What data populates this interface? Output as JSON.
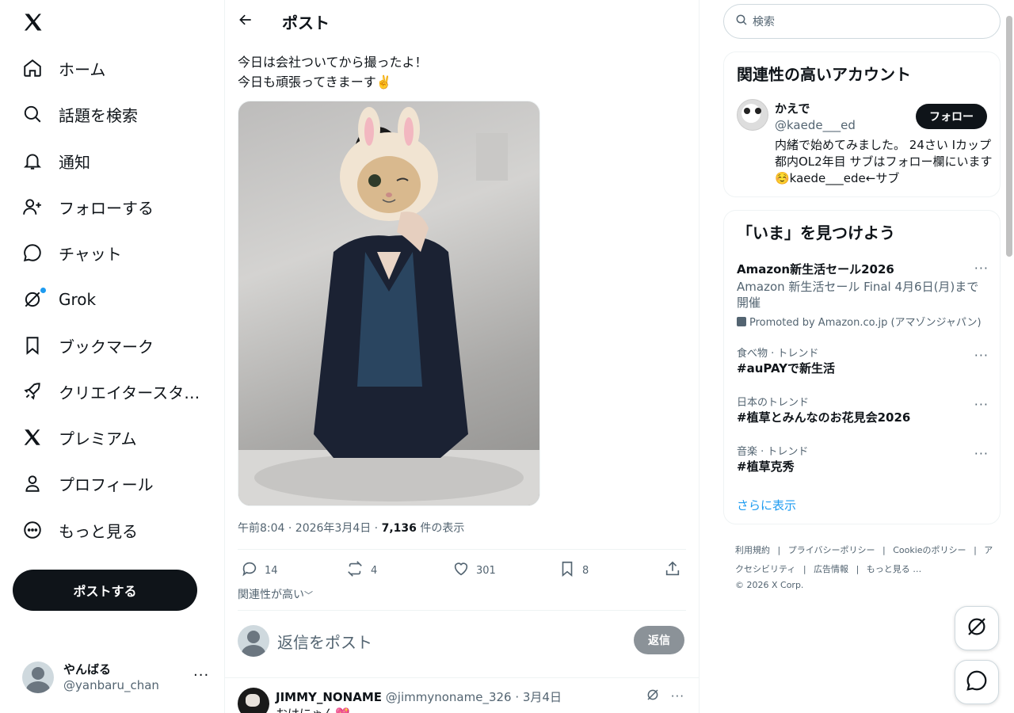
{
  "nav": {
    "items": [
      {
        "label": "ホーム",
        "icon": "home-icon"
      },
      {
        "label": "話題を検索",
        "icon": "search-icon"
      },
      {
        "label": "通知",
        "icon": "bell-icon"
      },
      {
        "label": "フォローする",
        "icon": "person-add-icon"
      },
      {
        "label": "チャット",
        "icon": "chat-icon"
      },
      {
        "label": "Grok",
        "icon": "grok-icon"
      },
      {
        "label": "ブックマーク",
        "icon": "bookmark-icon"
      },
      {
        "label": "クリエイタースタ…",
        "icon": "rocket-icon"
      },
      {
        "label": "プレミアム",
        "icon": "x-icon"
      },
      {
        "label": "プロフィール",
        "icon": "person-icon"
      },
      {
        "label": "もっと見る",
        "icon": "more-circle-icon"
      }
    ],
    "post_button": "ポストする",
    "account": {
      "name": "やんばる",
      "handle": "@yanbaru_chan",
      "more": "···"
    }
  },
  "header": {
    "title": "ポスト"
  },
  "post": {
    "line1": "今日は会社ついてから撮ったよ！",
    "line2": "今日も頑張ってきまーす✌️",
    "time": "午前8:04 · 2026年3月4日 · ",
    "views": "7,136",
    "views_suffix": " 件の表示",
    "replies": "14",
    "reposts": "4",
    "likes": "301",
    "bookmarks": "8",
    "sort_label": "関連性が高い"
  },
  "reply_box": {
    "placeholder": "返信をポスト",
    "button": "返信"
  },
  "reply": {
    "name": "JIMMY_NONAME",
    "meta": " @jimmynoname_326 · 3月4日",
    "text": "おはにゃん💖"
  },
  "search": {
    "placeholder": "検索"
  },
  "relevant": {
    "title": "関連性の高いアカウント",
    "name": "かえで",
    "handle": "@kaede___ed",
    "bio": "内緒で始めてみました。 24さい Iカップ 都内OL2年目 サブはフォロー欄にいます☺️kaede___ede←サブ",
    "follow": "フォロー"
  },
  "trends": {
    "title": "「いま」を見つけよう",
    "promo": {
      "title": "Amazon新生活セール2026",
      "desc": "Amazon 新生活セール Final 4月6日(月)まで開催",
      "by": "Promoted by Amazon.co.jp (アマゾンジャパン)"
    },
    "items": [
      {
        "meta": "食べ物 · トレンド",
        "title": "#auPAYで新生活"
      },
      {
        "meta": "日本のトレンド",
        "title": "#植草とみんなのお花見会2026"
      },
      {
        "meta": "音楽 · トレンド",
        "title": "#植草克秀"
      }
    ],
    "more_dots": "···",
    "show_more": "さらに表示"
  },
  "footer": {
    "links": [
      "利用規約",
      "|",
      "プライバシーポリシー",
      "|",
      "Cookieのポリシー",
      "|",
      "アクセシビリティ",
      "|",
      "広告情報",
      "|",
      "もっと見る …"
    ],
    "copyright": "© 2026 X Corp."
  }
}
